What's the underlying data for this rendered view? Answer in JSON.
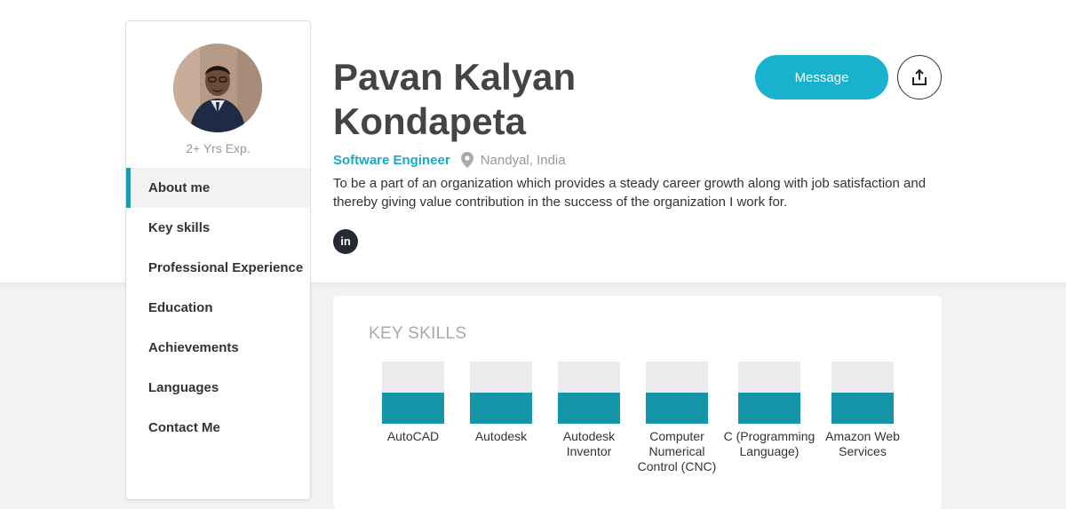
{
  "profile": {
    "experience": "2+ Yrs Exp.",
    "name": "Pavan Kalyan Kondapeta",
    "role": "Software Engineer",
    "location": "Nandyal, India",
    "summary": "To be a part of an organization which provides a steady career growth along with job satisfaction and thereby giving value contribution in the success of the organization I work for.",
    "linkedin_label": "in"
  },
  "actions": {
    "message_label": "Message",
    "share_icon": "share-icon"
  },
  "nav": {
    "items": [
      {
        "label": "About me",
        "active": true
      },
      {
        "label": "Key skills"
      },
      {
        "label": "Professional Experience"
      },
      {
        "label": "Education"
      },
      {
        "label": "Achievements"
      },
      {
        "label": "Languages"
      },
      {
        "label": "Contact Me"
      }
    ]
  },
  "skills": {
    "title": "KEY SKILLS",
    "items": [
      {
        "label": "AutoCAD",
        "level": 0.5
      },
      {
        "label": "Autodesk",
        "level": 0.5
      },
      {
        "label": "Autodesk Inventor",
        "level": 0.5
      },
      {
        "label": "Computer Numerical Control (CNC)",
        "level": 0.5
      },
      {
        "label": "C (Programming Language)",
        "level": 0.5
      },
      {
        "label": "Amazon Web Services",
        "level": 0.5
      }
    ]
  },
  "colors": {
    "accent": "#18b2cf",
    "skill_fill": "#1496a8",
    "nav_active_border": "#1a9bb3"
  }
}
